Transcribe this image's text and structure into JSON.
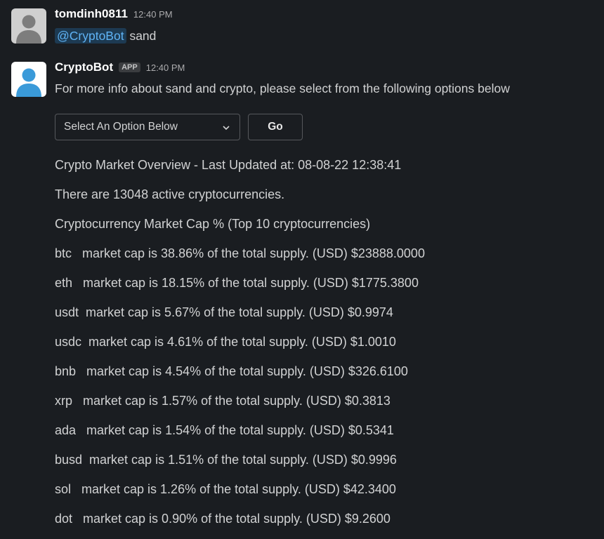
{
  "messages": [
    {
      "username": "tomdinh0811",
      "timestamp": "12:40 PM",
      "mention": "@CryptoBot",
      "text": " sand"
    },
    {
      "username": "CryptoBot",
      "badge": "APP",
      "timestamp": "12:40 PM",
      "text": "For more info about sand and crypto, please select from the following options below"
    }
  ],
  "controls": {
    "select_placeholder": "Select An Option Below",
    "go_label": "Go"
  },
  "overview": {
    "title": "Crypto Market Overview - Last Updated at: 08-08-22 12:38:41",
    "active": "There are 13048 active cryptocurrencies.",
    "heading": "Cryptocurrency Market Cap % (Top 10 cryptocurrencies)",
    "rows": [
      "btc   market cap is 38.86% of the total supply. (USD) $23888.0000",
      "eth   market cap is 18.15% of the total supply. (USD) $1775.3800",
      "usdt  market cap is 5.67% of the total supply. (USD) $0.9974",
      "usdc  market cap is 4.61% of the total supply. (USD) $1.0010",
      "bnb   market cap is 4.54% of the total supply. (USD) $326.6100",
      "xrp   market cap is 1.57% of the total supply. (USD) $0.3813",
      "ada   market cap is 1.54% of the total supply. (USD) $0.5341",
      "busd  market cap is 1.51% of the total supply. (USD) $0.9996",
      "sol   market cap is 1.26% of the total supply. (USD) $42.3400",
      "dot   market cap is 0.90% of the total supply. (USD) $9.2600"
    ]
  },
  "icons": {
    "user_avatar": "user-silhouette-icon",
    "bot_avatar": "bot-silhouette-icon",
    "select_chevron": "chevron-down-icon"
  },
  "colors": {
    "background": "#1a1d21",
    "mention": "#5fb3f5",
    "user_avatar_bg": "#c8c8c8",
    "bot_avatar_bg": "#ffffff",
    "bot_avatar_fg": "#3a9ad9"
  }
}
